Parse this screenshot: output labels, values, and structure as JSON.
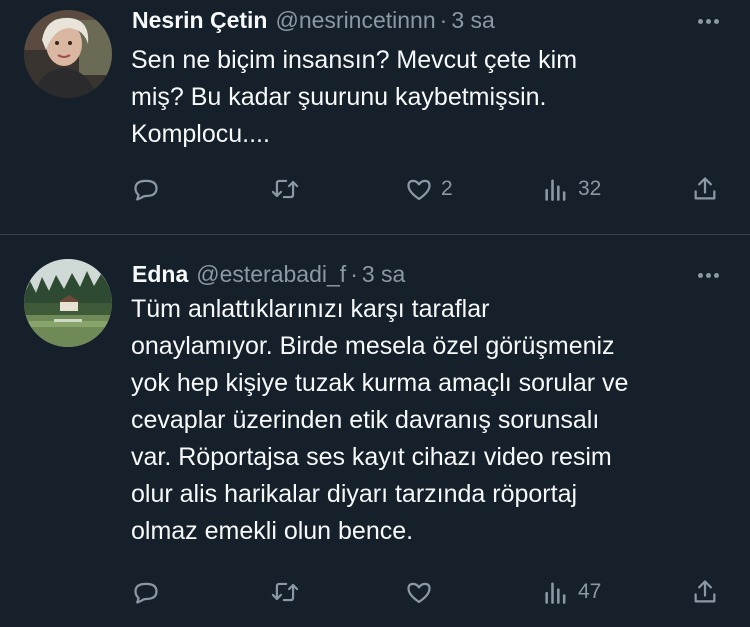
{
  "tweets": [
    {
      "name": "Nesrin Çetin",
      "handle": "@nesrincetinnn",
      "separator": "·",
      "time": "3 sa",
      "lines": [
        "Sen ne biçim insansın? Mevcut çete kim",
        "miş? Bu kadar şuurunu kaybetmişsin.",
        "Komplocu...."
      ],
      "likes": "2",
      "views": "32"
    },
    {
      "name": "Edna",
      "handle": "@esterabadi_f",
      "separator": "·",
      "time": "3 sa",
      "lines": [
        "Tüm anlattıklarınızı karşı taraflar",
        "onaylamıyor. Birde mesela özel görüşmeniz",
        "yok hep kişiye tuzak kurma amaçlı sorular ve",
        "cevaplar üzerinden etik davranış sorunsalı",
        "var. Röportajsa ses kayıt cihazı video resim",
        "olur alis harikalar diyarı tarzında röportaj",
        "olmaz emekli olun bence."
      ],
      "views": "47"
    }
  ],
  "icons": {
    "reply": "reply-icon",
    "retweet": "retweet-icon",
    "like": "heart-icon",
    "views": "views-icon",
    "share": "share-icon",
    "more": "more-icon"
  },
  "colors": {
    "background": "#15202b",
    "text": "#f7f9f9",
    "secondary": "#8b98a5",
    "divider": "#38444d"
  }
}
